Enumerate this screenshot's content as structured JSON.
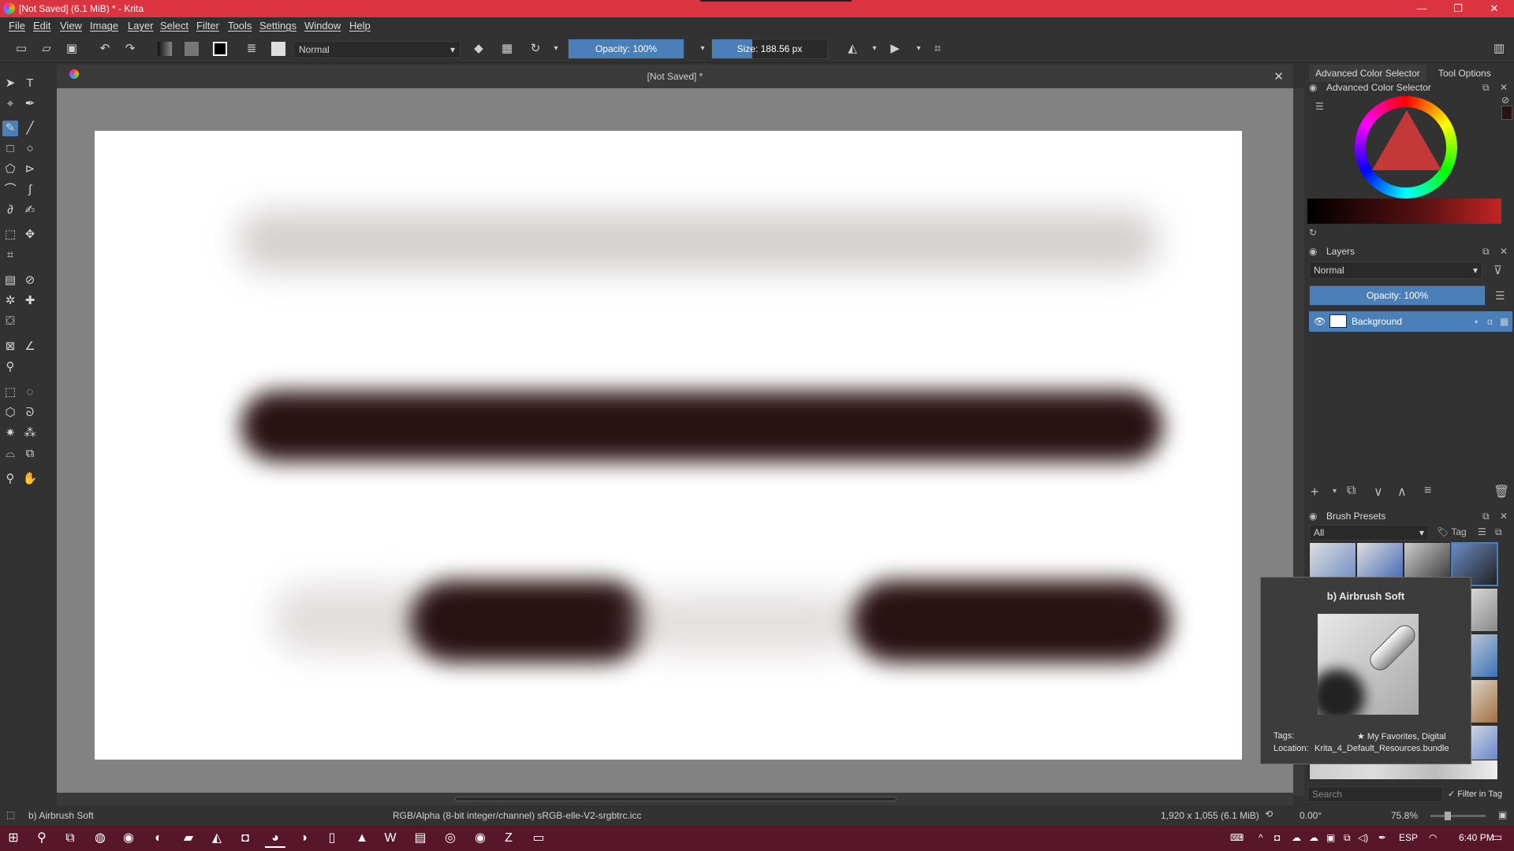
{
  "window": {
    "title": "[Not Saved]  (6.1 MiB)  * - Krita",
    "minimize": "—",
    "maximize": "❐",
    "close": "✕"
  },
  "menu": [
    "File",
    "Edit",
    "View",
    "Image",
    "Layer",
    "Select",
    "Filter",
    "Tools",
    "Settings",
    "Window",
    "Help"
  ],
  "toolbar": {
    "blend_mode": "Normal",
    "opacity_label": "Opacity: 100%",
    "opacity_fraction": 1.0,
    "size_label": "Size: 188.56 px",
    "size_fraction": 0.35
  },
  "document": {
    "tab_title": "[Not Saved]  *",
    "close": "✕"
  },
  "dockers": {
    "tabs": [
      "Advanced Color Selector",
      "Tool Options"
    ],
    "color_selector_title": "Advanced Color Selector",
    "layers_title": "Layers",
    "layers_blend": "Normal",
    "layers_opacity": "Opacity:  100%",
    "layer_name": "Background",
    "brush_presets_title": "Brush Presets",
    "brush_filter": "All",
    "tag_label": "Tag",
    "search_placeholder": "Search",
    "filter_in_tag": "Filter in Tag",
    "selected_color": "#2a1214"
  },
  "tooltip": {
    "title": "b) Airbrush Soft",
    "tags_label": "Tags:",
    "tags_value": "★ My Favorites, Digital",
    "location_label": "Location:",
    "location_value": "Krita_4_Default_Resources.bundle"
  },
  "status": {
    "brush": "b) Airbrush Soft",
    "colorspace": "RGB/Alpha (8-bit integer/channel)  sRGB-elle-V2-srgbtrc.icc",
    "dimensions": "1,920 x 1,055 (6.1 MiB)",
    "rotation": "0.00°",
    "zoom": "75.8%"
  },
  "taskbar": {
    "lang": "ESP",
    "time": "6:40 PM"
  }
}
